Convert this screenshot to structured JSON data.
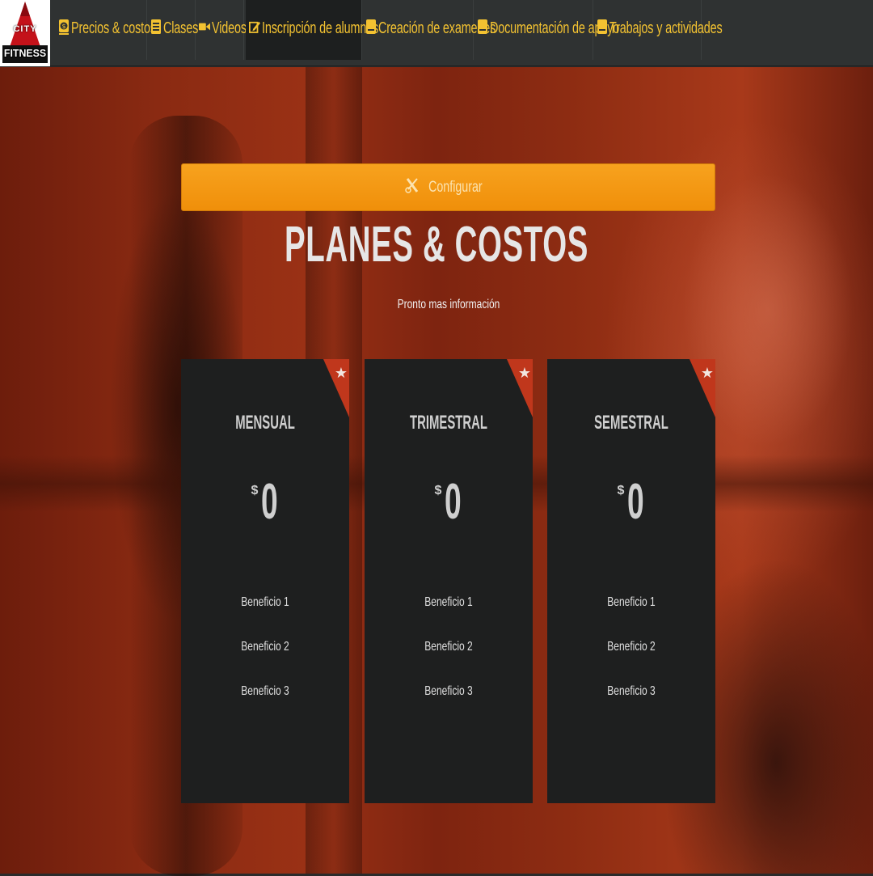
{
  "logo": {
    "line1": "CITY",
    "line2": "FITNESS"
  },
  "nav": {
    "items": [
      {
        "label": "Precios & costos",
        "icon": "dollar-icon",
        "active": false
      },
      {
        "label": "Clases",
        "icon": "calendar-icon",
        "active": false
      },
      {
        "label": "Videos",
        "icon": "video-camera-icon",
        "active": false
      },
      {
        "label": "Inscripción de alumnos",
        "icon": "edit-icon",
        "active": true
      },
      {
        "label": "Creación de examenes",
        "icon": "book-icon",
        "active": false
      },
      {
        "label": "Documentación de apoyo",
        "icon": "book-icon",
        "active": false
      },
      {
        "label": "Trabajos y actividades",
        "icon": "book-icon",
        "active": false
      }
    ]
  },
  "hero": {
    "config_label": "Configurar",
    "title": "PLANES & COSTOS",
    "subtitle": "Pronto mas información"
  },
  "plans": [
    {
      "name": "MENSUAL",
      "currency": "$",
      "amount": "0",
      "benefits": [
        "Beneficio 1",
        "Beneficio 2",
        "Beneficio 3"
      ]
    },
    {
      "name": "TRIMESTRAL",
      "currency": "$",
      "amount": "0",
      "benefits": [
        "Beneficio 1",
        "Beneficio 2",
        "Beneficio 3"
      ]
    },
    {
      "name": "SEMESTRAL",
      "currency": "$",
      "amount": "0",
      "benefits": [
        "Beneficio 1",
        "Beneficio 2",
        "Beneficio 3"
      ]
    }
  ],
  "colors": {
    "nav_bg": "#2f3232",
    "nav_text": "#f3c231",
    "accent_button": "#f29612",
    "card_bg": "#1e1f1f",
    "ribbon": "#c0371c"
  }
}
